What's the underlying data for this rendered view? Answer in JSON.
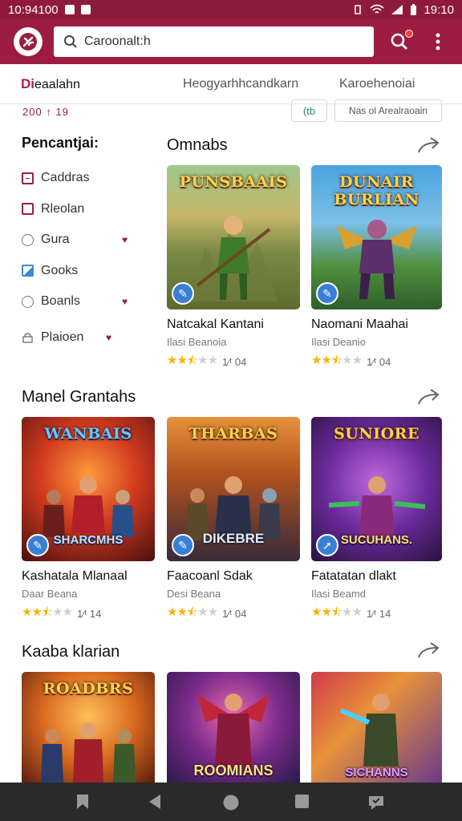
{
  "status": {
    "time_left": "10:94100",
    "time_right": "19:10"
  },
  "appbar": {
    "search_placeholder": "Caroonalt:h"
  },
  "tabs": [
    {
      "mark": "Di",
      "label": "eaalahn"
    },
    {
      "label": "Heogyarhhcandkarn"
    },
    {
      "label": "Karoehenoiai"
    }
  ],
  "subbar": {
    "sort_label": "200 ↑ 19",
    "chip1": "(tb",
    "chip2": "Nas ol Arealraoain"
  },
  "sidebar": {
    "title": "Pencantjai:",
    "items": [
      {
        "label": "Caddras",
        "icon": "square-minus-icon"
      },
      {
        "label": "Rleolan",
        "icon": "square-icon"
      },
      {
        "label": "Gura",
        "icon": "circle-icon",
        "heart": true
      },
      {
        "label": "Gooks",
        "icon": "square-blue-icon"
      },
      {
        "label": "Boanls",
        "icon": "circle-icon",
        "heart": true
      },
      {
        "label": "Plaioen",
        "icon": "lock-icon",
        "heart": true
      }
    ]
  },
  "sections": [
    {
      "title": "Omnabs",
      "cards": [
        {
          "name": "Natcakal Kantani",
          "category": "Ilasi Beanoia",
          "rating_text": "1⁄ᵗ 04",
          "stars": 2.5,
          "img_title": "PUNSBAAIS",
          "img_sub": ""
        },
        {
          "name": "Naomani Maahai",
          "category": "Ilasi Deanio",
          "rating_text": "1⁄ᵗ 04",
          "stars": 2.5,
          "img_title": "DUNAIR BURLIAN",
          "img_sub": ""
        }
      ]
    },
    {
      "title": "Manel Grantahs",
      "cards": [
        {
          "name": "Kashatala Mlanaal",
          "category": "Daar Beana",
          "rating_text": "1⁄ᵗ 14",
          "stars": 2.5,
          "img_title": "WANBAIS",
          "img_sub": "SHARCMHS"
        },
        {
          "name": "Faacoanl Sdak",
          "category": "Desi Beana",
          "rating_text": "1⁄ᵗ 04",
          "stars": 2.5,
          "img_title": "THARBAS",
          "img_sub": "DIKEBRE"
        },
        {
          "name": "Fatatatan dlakt",
          "category": "Ilasi Beamd",
          "rating_text": "1⁄ᵗ 14",
          "stars": 2.5,
          "img_title": "SUNIORE",
          "img_sub": "SUCUHANS."
        }
      ]
    },
    {
      "title": "Kaaba klarian",
      "cards": [
        {
          "name": "",
          "category": "",
          "rating_text": "",
          "stars": 0,
          "img_title": "ROADBRS",
          "img_sub": ""
        },
        {
          "name": "",
          "category": "",
          "rating_text": "",
          "stars": 0,
          "img_title": "",
          "img_sub": "ROOMIANS"
        },
        {
          "name": "",
          "category": "",
          "rating_text": "",
          "stars": 0,
          "img_title": "",
          "img_sub": "SICHANNS"
        }
      ]
    }
  ],
  "colors": {
    "brand": "#9c1c42",
    "star": "#f4b400",
    "badge": "#3a7fd6",
    "navbar": "#2a2a2a"
  }
}
